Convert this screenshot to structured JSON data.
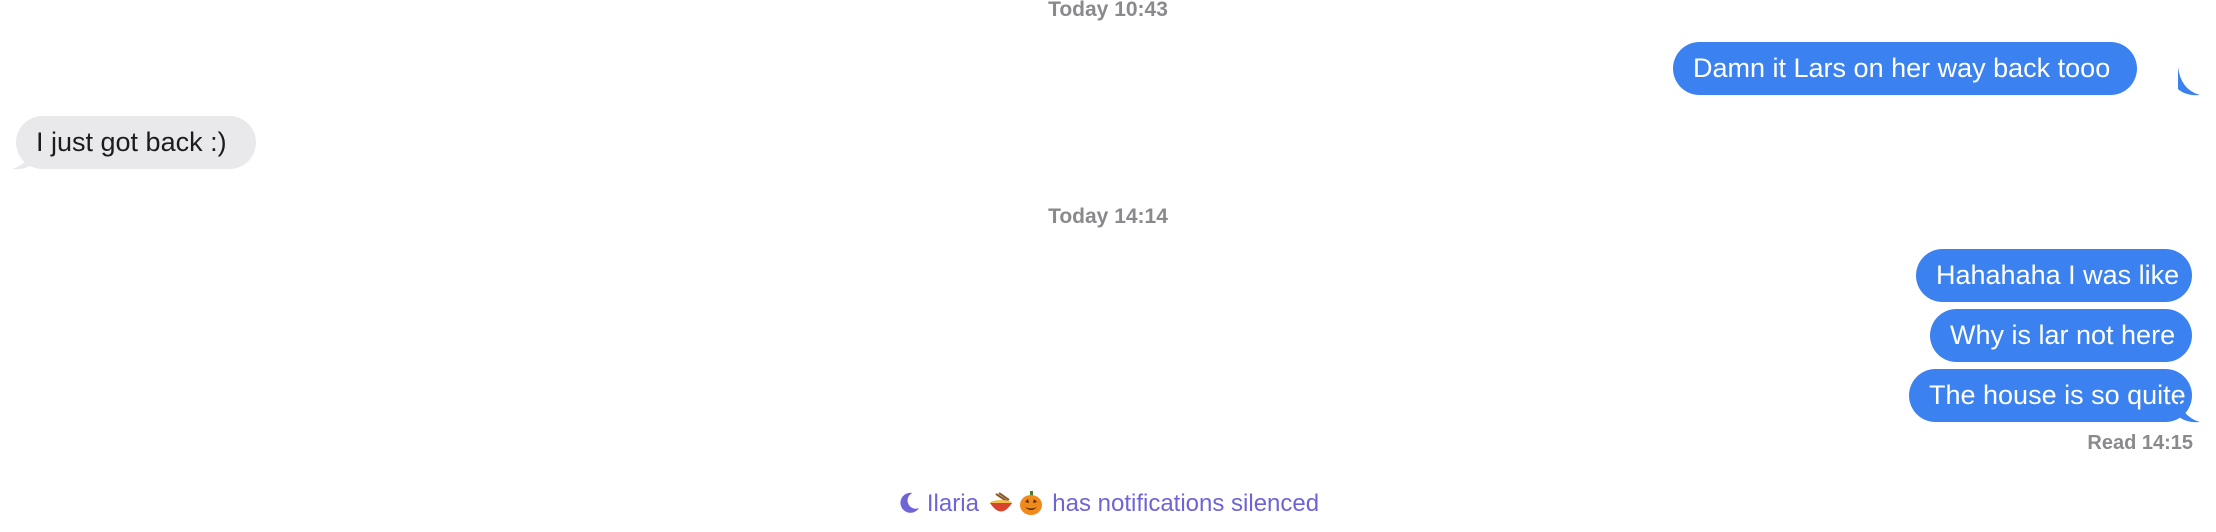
{
  "conversation": {
    "timestamps": [
      "Today 10:43",
      "Today 14:14"
    ],
    "messages": [
      {
        "from": "me",
        "text": "Damn it Lars on her way back tooo"
      },
      {
        "from": "them",
        "text": "I just got back :)"
      },
      {
        "from": "me",
        "text": "Hahahaha I was like"
      },
      {
        "from": "me",
        "text": "Why is lar not here"
      },
      {
        "from": "me",
        "text": "The house is so quite"
      }
    ],
    "read_receipt": "Read 14:15",
    "notification_banner": {
      "icon": "moon-icon",
      "contact_name": "Ilaria",
      "emoji_icons": [
        "ramen-bowl-icon",
        "jack-o-lantern-icon"
      ],
      "suffix": "has notifications silenced"
    }
  },
  "colors": {
    "outgoing_bubble": "#3b82f0",
    "incoming_bubble": "#e9e9eb",
    "timestamp_text": "#8a8a8e",
    "focus_banner": "#6e64d8"
  }
}
